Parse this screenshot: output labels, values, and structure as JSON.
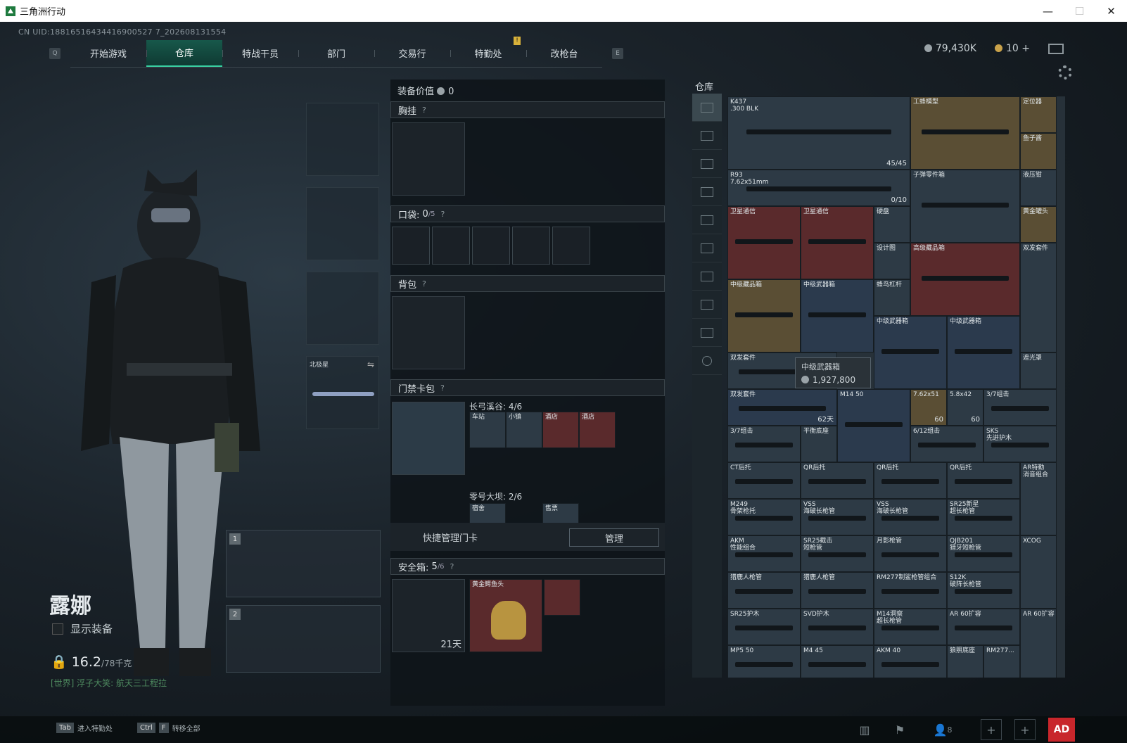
{
  "window": {
    "title": "三角洲行动",
    "minimize": "—",
    "maximize": "☐",
    "close": "✕"
  },
  "header": {
    "uid": "CN UID:18816516434416900527 7_202608131554",
    "key_left": "Q",
    "key_right": "E",
    "warn": "!",
    "tabs": [
      {
        "label": "开始游戏"
      },
      {
        "label": "仓库"
      },
      {
        "label": "特战干员"
      },
      {
        "label": "部门"
      },
      {
        "label": "交易行"
      },
      {
        "label": "特勤处"
      },
      {
        "label": "改枪台"
      }
    ],
    "currency": "79,430K",
    "coins": "10",
    "plus": "+"
  },
  "character": {
    "name": "露娜",
    "show_equipment": "显示装备",
    "weight": "16.2",
    "weight_max": "/78千克",
    "world_chat": "[世界] 浮子大笑: 航天三工程拉"
  },
  "slots": {
    "sidearm_label": "北极星",
    "weapon1": "1",
    "weapon2": "2"
  },
  "loadout": {
    "value_label": "装备价值",
    "value": "0",
    "chest": "胸挂",
    "pockets_label": "口袋:",
    "pockets_value": "0",
    "pockets_max": "/5",
    "backpack": "背包",
    "keycard": "门禁卡包",
    "map1": "长弓溪谷: 4/6",
    "map2": "零号大坝: 2/6",
    "cards": [
      "车站",
      "小镇",
      "酒店",
      "酒店"
    ],
    "cards2": [
      "宿舍",
      "售票"
    ],
    "quick_manage": "快捷管理门卡",
    "manage_btn": "管理",
    "safebox_label": "安全箱:",
    "safebox_value": "5",
    "safebox_max": "/6",
    "gold_item": "黄金鳄鱼头",
    "timer": "21天",
    "help": "?"
  },
  "warehouse": {
    "title": "仓库",
    "tooltip": {
      "name": "中级武器箱",
      "price": "1,927,800"
    },
    "items": [
      {
        "l": "K437\n.300 BLK",
        "c": "45/45"
      },
      {
        "l": "工蜂模型"
      },
      {
        "l": "定位器"
      },
      {
        "l": "鱼子酱"
      },
      {
        "l": "R93\n7.62x51mm",
        "c": "0/10"
      },
      {
        "l": "子弹零件箱"
      },
      {
        "l": "液压钳"
      },
      {
        "l": "卫星通信"
      },
      {
        "l": "卫星通信"
      },
      {
        "l": "硬盘"
      },
      {
        "l": "黄金罐头"
      },
      {
        "l": "设计图"
      },
      {
        "l": "高级藏品箱"
      },
      {
        "l": "双发套件"
      },
      {
        "l": "中级藏品箱"
      },
      {
        "l": "中级武器箱"
      },
      {
        "l": "蜂鸟杠杆"
      },
      {
        "l": "中级武器箱"
      },
      {
        "l": "中级武器箱"
      },
      {
        "l": "遮光罩"
      },
      {
        "l": "双发套件",
        "c": "62天"
      },
      {
        "l": "双发套件",
        "c": "62天"
      },
      {
        "l": "M14 50"
      },
      {
        "l": "7.62x51",
        "c": "60"
      },
      {
        "l": "5.8x42",
        "c": "60"
      },
      {
        "l": "3/7组击"
      },
      {
        "l": "3/7组击"
      },
      {
        "l": "平衡底座"
      },
      {
        "l": "6/12组击"
      },
      {
        "l": "SKS\n先进护木"
      },
      {
        "l": "CT后托"
      },
      {
        "l": "QR后托"
      },
      {
        "l": "QR后托"
      },
      {
        "l": "QR后托"
      },
      {
        "l": "AR特勤\n消音组合"
      },
      {
        "l": "M249\n骨架枪托"
      },
      {
        "l": "VSS\n海破长枪管"
      },
      {
        "l": "VSS\n海破长枪管"
      },
      {
        "l": "SR25新星\n超长枪管"
      },
      {
        "l": "AKM\n性能组合"
      },
      {
        "l": "SR25截击\n短枪管"
      },
      {
        "l": "月影枪管"
      },
      {
        "l": "QJB201\n猎牙短枪管"
      },
      {
        "l": "XCOG"
      },
      {
        "l": "猎鹿人枪管"
      },
      {
        "l": "猎鹿人枪管"
      },
      {
        "l": "RM277制鲨枪管组合"
      },
      {
        "l": "S12K\n破阵长枪管"
      },
      {
        "l": "SR25护木"
      },
      {
        "l": "SVD护木"
      },
      {
        "l": "M14洞察\n超长枪管"
      },
      {
        "l": "AR 60扩容"
      },
      {
        "l": "AR 60扩容"
      },
      {
        "l": "MP5 50"
      },
      {
        "l": "M4 45"
      },
      {
        "l": "AKM 40"
      },
      {
        "l": "狼照底座"
      },
      {
        "l": "RM277..."
      }
    ]
  },
  "bottom": {
    "tab_key": "Tab",
    "tab_label": "进入特勤处",
    "ctrl": "Ctrl",
    "f": "F",
    "transfer": "转移全部",
    "friends": "8",
    "ad": "AD"
  },
  "colors": {
    "accent": "#3ad0a2",
    "red_item": "#5a2a2c",
    "gold_item": "#5a4e34"
  }
}
